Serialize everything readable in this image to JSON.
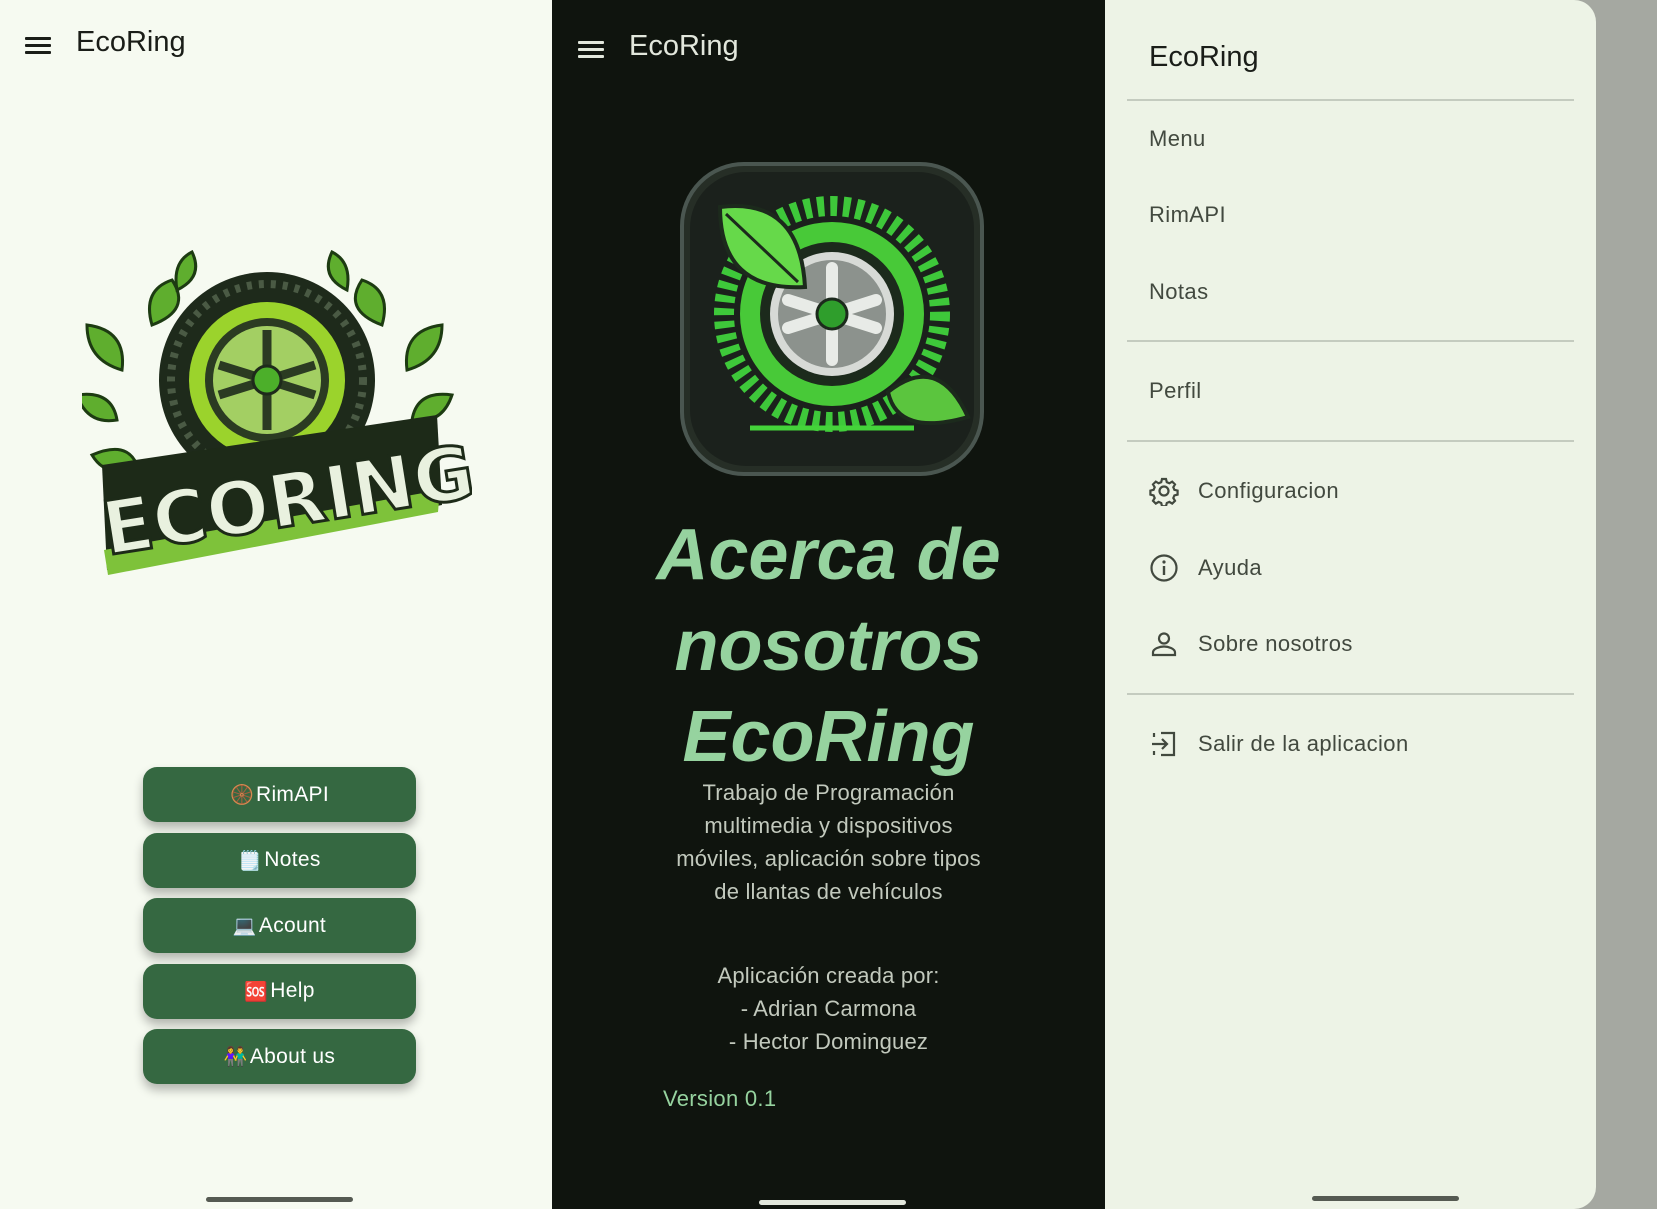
{
  "home": {
    "app_title": "EcoRing",
    "logo_text": "ECORING",
    "buttons": [
      {
        "icon": "🛞",
        "label": "RimAPI"
      },
      {
        "icon": "🗒️",
        "label": "Notes"
      },
      {
        "icon": "💻",
        "label": "Acount"
      },
      {
        "icon": "🆘",
        "label": "Help"
      },
      {
        "icon": "👫",
        "label": "About us"
      }
    ]
  },
  "about": {
    "app_title": "EcoRing",
    "title_line1": "Acerca de",
    "title_line2": "nosotros",
    "title_line3": "EcoRing",
    "desc_line1": "Trabajo de Programación",
    "desc_line2": "multimedia y dispositivos",
    "desc_line3": "móviles, aplicación sobre tipos",
    "desc_line4": "de llantas de vehículos",
    "credits_line1": "Aplicación creada por:",
    "credits_line2": "- Adrian Carmona",
    "credits_line3": "- Hector Dominguez",
    "version": "Version 0.1"
  },
  "drawer": {
    "title": "EcoRing",
    "items": [
      {
        "label": "Menu"
      },
      {
        "label": "RimAPI"
      },
      {
        "label": "Notas"
      },
      {
        "label": "Perfil"
      },
      {
        "label": "Configuracion",
        "icon": "gear-icon"
      },
      {
        "label": "Ayuda",
        "icon": "info-icon"
      },
      {
        "label": "Sobre nosotros",
        "icon": "person-icon"
      },
      {
        "label": "Salir de la aplicacion",
        "icon": "logout-icon"
      }
    ]
  },
  "colors": {
    "button_green": "#356841",
    "accent_light_green": "#96d39f",
    "dark_background": "#0f140e",
    "light_background": "#f6faf1",
    "drawer_background": "#edf3e6",
    "scrim": "#a5a8a1"
  }
}
